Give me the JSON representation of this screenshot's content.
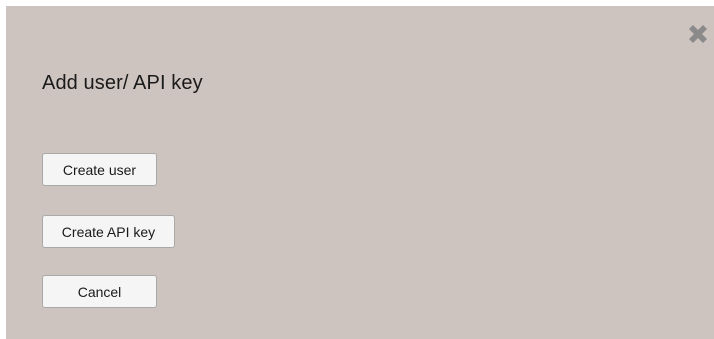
{
  "dialog": {
    "title": "Add user/ API key",
    "close_icon": "close-x-icon",
    "buttons": {
      "create_user": "Create user",
      "create_api_key": "Create API key",
      "cancel": "Cancel"
    }
  },
  "colors": {
    "dialog_background": "#cdc3bf",
    "close_icon": "#8a8a8a",
    "button_background": "#f5f5f5",
    "button_border": "#a9a9a9",
    "text": "#1a1a1a"
  }
}
